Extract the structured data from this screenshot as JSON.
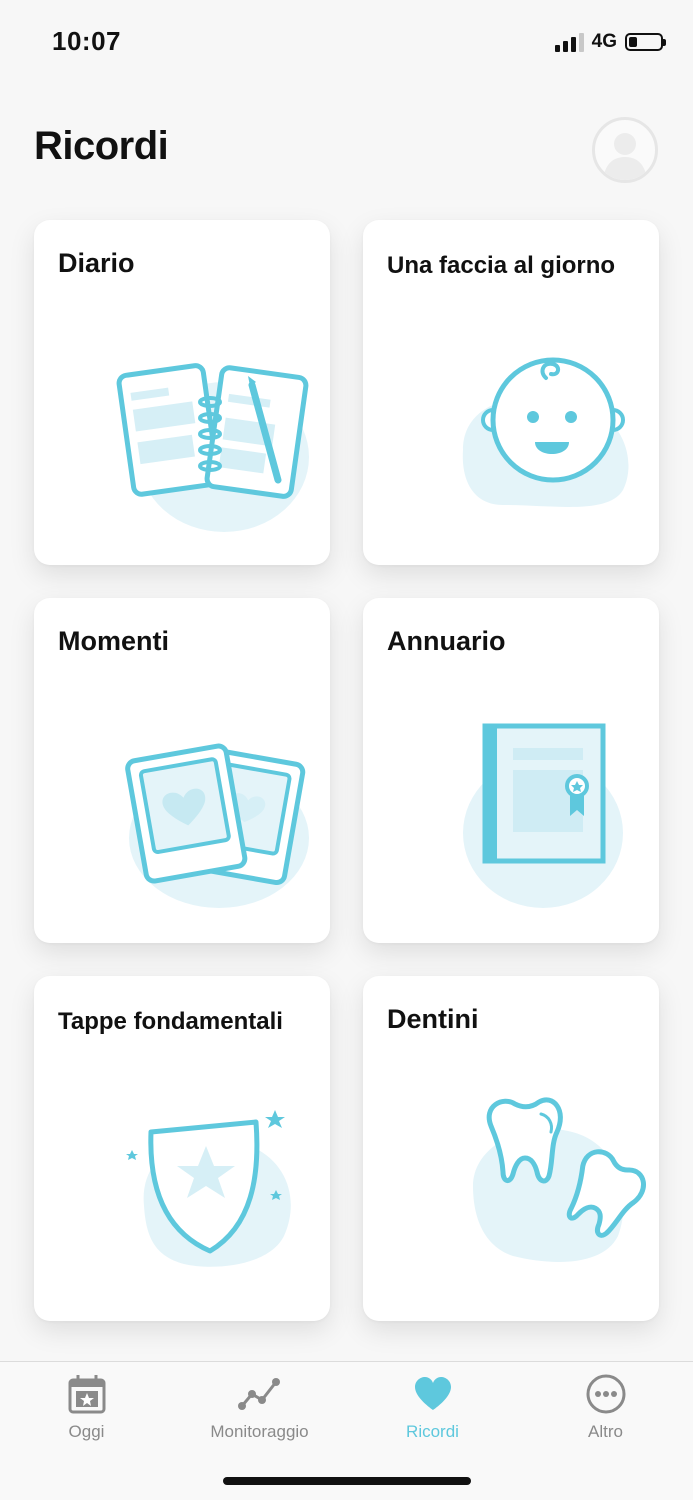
{
  "status_bar": {
    "time": "10:07",
    "network": "4G",
    "signal_bars": 3,
    "battery_level": 0.25
  },
  "header": {
    "title": "Ricordi",
    "avatar_icon": "profile-avatar-icon"
  },
  "colors": {
    "accent": "#5ec8dd",
    "accent_light": "#e4f4f9",
    "inactive": "#8a8a8a"
  },
  "cards": [
    {
      "title": "Diario",
      "icon": "diary-icon"
    },
    {
      "title": "Una faccia al giorno",
      "icon": "baby-face-icon"
    },
    {
      "title": "Momenti",
      "icon": "photos-icon"
    },
    {
      "title": "Annuario",
      "icon": "yearbook-icon"
    },
    {
      "title": "Tappe fondamentali",
      "icon": "milestone-shield-icon"
    },
    {
      "title": "Dentini",
      "icon": "teeth-icon"
    }
  ],
  "tab_bar": {
    "tabs": [
      {
        "label": "Oggi",
        "icon": "calendar-star-icon",
        "active": false
      },
      {
        "label": "Monitoraggio",
        "icon": "chart-line-icon",
        "active": false
      },
      {
        "label": "Ricordi",
        "icon": "heart-icon",
        "active": true
      },
      {
        "label": "Altro",
        "icon": "more-dots-icon",
        "active": false
      }
    ]
  }
}
